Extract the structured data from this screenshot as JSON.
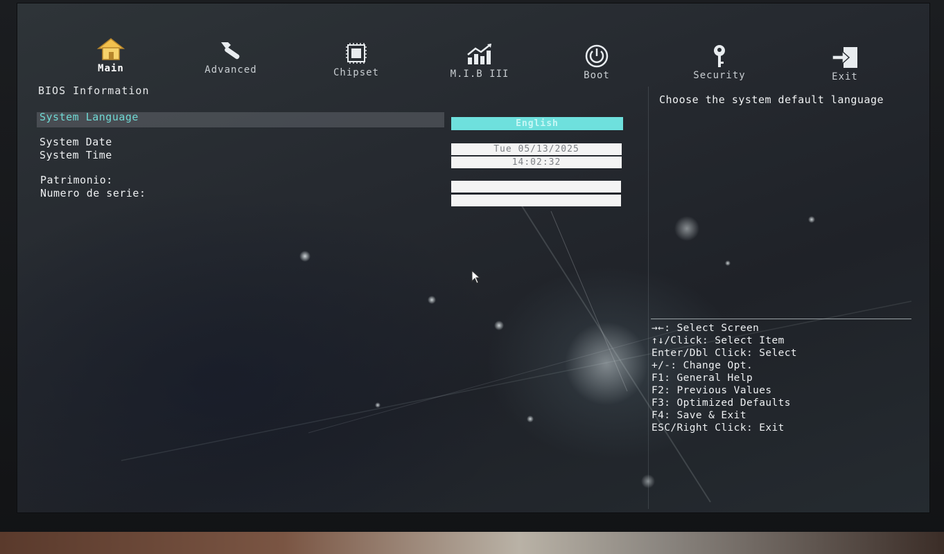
{
  "nav": {
    "tabs": [
      {
        "label": "Main",
        "icon": "home-icon",
        "active": true
      },
      {
        "label": "Advanced",
        "icon": "wrench-icon"
      },
      {
        "label": "Chipset",
        "icon": "chip-icon"
      },
      {
        "label": "M.I.B III",
        "icon": "chart-icon"
      },
      {
        "label": "Boot",
        "icon": "power-icon"
      },
      {
        "label": "Security",
        "icon": "key-icon"
      },
      {
        "label": "Exit",
        "icon": "exit-icon"
      }
    ]
  },
  "main": {
    "section_title": "BIOS Information",
    "language": {
      "label": "System Language",
      "value": "English"
    },
    "date": {
      "label": "System Date",
      "value": "Tue 05/13/2025"
    },
    "time": {
      "label": "System Time",
      "value": "14:02:32"
    },
    "patrimonio": {
      "label": "Patrimonio:",
      "value": ""
    },
    "serial": {
      "label": "Numero de serie:",
      "value": ""
    }
  },
  "help": {
    "description": "Choose the system default language",
    "keys": [
      "→←: Select Screen",
      "↑↓/Click: Select Item",
      "Enter/Dbl Click: Select",
      "+/-: Change Opt.",
      "F1: General Help",
      "F2: Previous Values",
      "F3: Optimized Defaults",
      "F4: Save & Exit",
      "ESC/Right Click: Exit"
    ]
  },
  "colors": {
    "accent": "#6ee0dd",
    "selected_text": "#6fd9d4",
    "home_icon": "#f2c14e"
  }
}
